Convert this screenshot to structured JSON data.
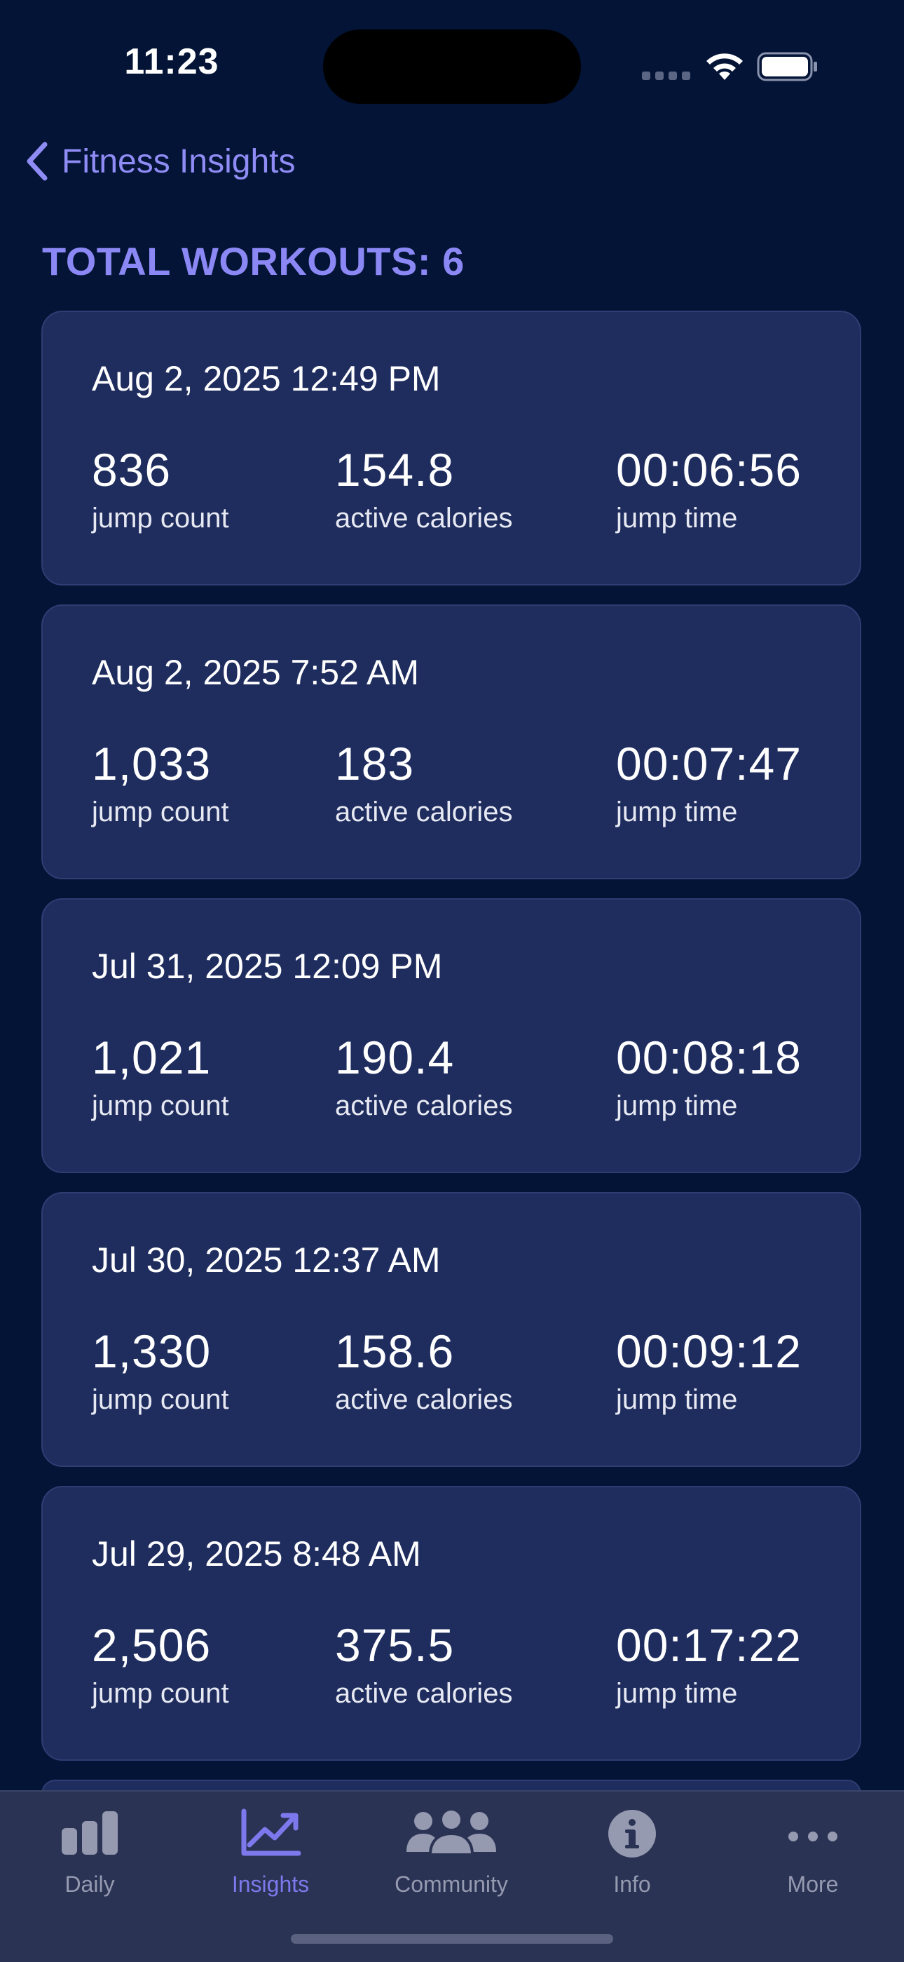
{
  "status_bar": {
    "time": "11:23"
  },
  "nav": {
    "back_label": "Fitness Insights",
    "back_icon": "chevron-left-icon"
  },
  "summary": {
    "total_workouts": "TOTAL WORKOUTS: 6"
  },
  "workouts": [
    {
      "date": "Aug 2, 2025 12:49 PM",
      "jump_count": "836",
      "jump_count_label": "jump count",
      "active_calories": "154.8",
      "active_calories_label": "active calories",
      "jump_time": "00:06:56",
      "jump_time_label": "jump time"
    },
    {
      "date": "Aug 2, 2025 7:52 AM",
      "jump_count": "1,033",
      "jump_count_label": "jump count",
      "active_calories": "183",
      "active_calories_label": "active calories",
      "jump_time": "00:07:47",
      "jump_time_label": "jump time"
    },
    {
      "date": "Jul 31, 2025 12:09 PM",
      "jump_count": "1,021",
      "jump_count_label": "jump count",
      "active_calories": "190.4",
      "active_calories_label": "active calories",
      "jump_time": "00:08:18",
      "jump_time_label": "jump time"
    },
    {
      "date": "Jul 30, 2025 12:37 AM",
      "jump_count": "1,330",
      "jump_count_label": "jump count",
      "active_calories": "158.6",
      "active_calories_label": "active calories",
      "jump_time": "00:09:12",
      "jump_time_label": "jump time"
    },
    {
      "date": "Jul 29, 2025 8:48 AM",
      "jump_count": "2,506",
      "jump_count_label": "jump count",
      "active_calories": "375.5",
      "active_calories_label": "active calories",
      "jump_time": "00:17:22",
      "jump_time_label": "jump time"
    }
  ],
  "tab_bar": {
    "tabs": [
      {
        "label": "Daily",
        "icon": "bar-chart-icon",
        "active": false
      },
      {
        "label": "Insights",
        "icon": "trend-chart-icon",
        "active": true
      },
      {
        "label": "Community",
        "icon": "people-icon",
        "active": false
      },
      {
        "label": "Info",
        "icon": "info-icon",
        "active": false
      },
      {
        "label": "More",
        "icon": "more-icon",
        "active": false
      }
    ]
  },
  "colors": {
    "background": "#031436",
    "card": "#1e2c5e",
    "accent": "#8b88f5",
    "tab_inactive": "#959ab0",
    "tab_active": "#7d79ec"
  }
}
